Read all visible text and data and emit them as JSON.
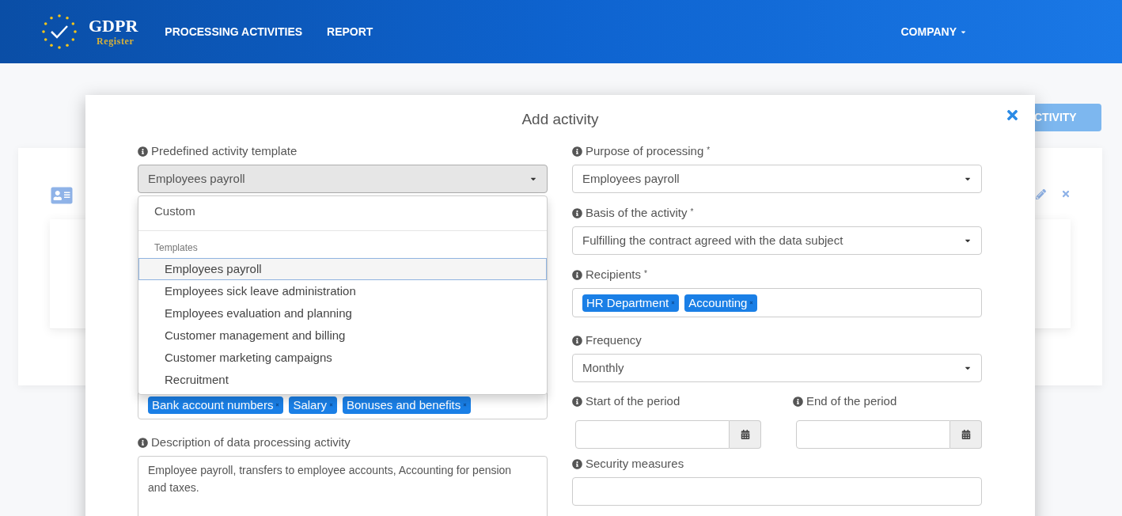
{
  "header": {
    "logo": {
      "title": "GDPR",
      "subtitle": "Register"
    },
    "nav": [
      {
        "label": "PROCESSING ACTIVITIES"
      },
      {
        "label": "REPORT"
      }
    ],
    "account_menu": "COMPANY"
  },
  "background": {
    "add_button": "CTIVITY"
  },
  "modal": {
    "title": "Add activity",
    "left": [
      {
        "kind": "select",
        "label": "Predefined activity template",
        "value": "Employees payroll",
        "open": true,
        "dropdown": {
          "custom": "Custom",
          "group": "Templates",
          "options": [
            {
              "label": "Employees payroll",
              "selected": true
            },
            {
              "label": "Employees sick leave administration",
              "selected": false
            },
            {
              "label": "Employees evaluation and planning",
              "selected": false
            },
            {
              "label": "Customer management and billing",
              "selected": false
            },
            {
              "label": "Customer marketing campaigns",
              "selected": false
            },
            {
              "label": "Recruitment",
              "selected": false
            }
          ]
        }
      },
      {
        "kind": "tags",
        "tags": [
          "Bank account numbers",
          "Salary",
          "Bonuses and benefits"
        ]
      },
      {
        "kind": "textarea",
        "label": "Description of data processing activity",
        "value": "Employee payroll, transfers to employee accounts, Accounting for pension and taxes."
      }
    ],
    "right": [
      {
        "kind": "select",
        "label": "Purpose of processing",
        "required_mark": "*",
        "value": "Employees payroll",
        "open": false
      },
      {
        "kind": "select",
        "label": "Basis of the activity",
        "required_mark": "*",
        "value": "Fulfilling the contract agreed with the data subject",
        "open": false
      },
      {
        "kind": "tags",
        "label": "Recipients",
        "required_mark": "*",
        "tags": [
          "HR Department",
          "Accounting"
        ]
      },
      {
        "kind": "select",
        "label": "Frequency",
        "value": "Monthly",
        "open": false
      },
      {
        "kind": "dates",
        "fields": [
          {
            "label": "Start of the period"
          },
          {
            "label": "End of the period"
          }
        ]
      },
      {
        "kind": "text",
        "label": "Security measures"
      }
    ]
  }
}
